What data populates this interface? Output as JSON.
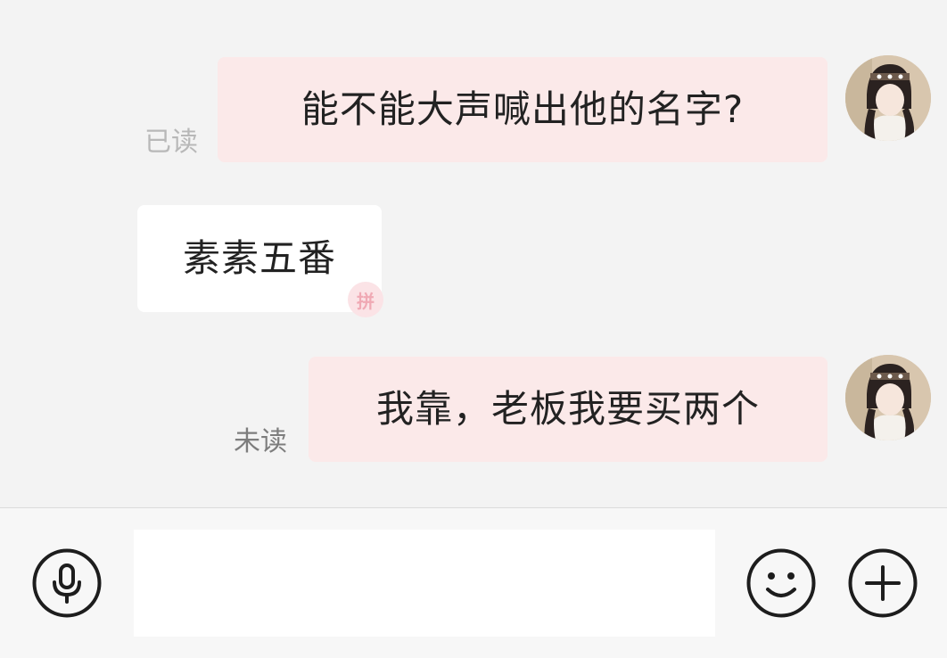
{
  "messages": [
    {
      "direction": "out",
      "text": "能不能大声喊出他的名字?",
      "status": "已读",
      "avatar": "user-avatar"
    },
    {
      "direction": "in",
      "text": "素素五番",
      "sticker_mark": "拼"
    },
    {
      "direction": "out",
      "text": "我靠，老板我要买两个",
      "status": "未读",
      "avatar": "user-avatar"
    }
  ],
  "input_bar": {
    "voice_icon": "microphone-icon",
    "text_value": "",
    "emoji_icon": "smiley-icon",
    "more_icon": "plus-icon"
  },
  "colors": {
    "chat_background": "#f3f3f3",
    "outgoing_bubble": "#fbe9e9",
    "incoming_bubble": "#ffffff",
    "input_bar_background": "#f7f7f7"
  }
}
